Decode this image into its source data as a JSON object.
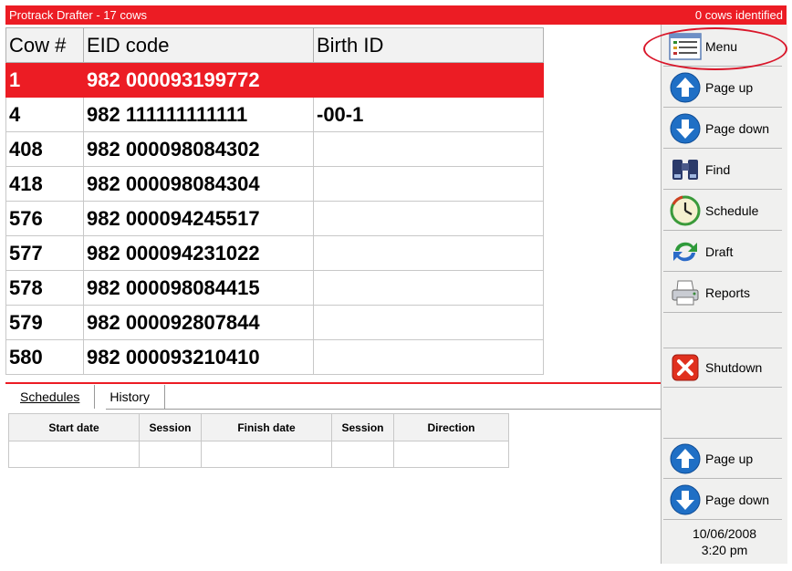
{
  "title": {
    "left": "Protrack Drafter - 17 cows",
    "right": "0 cows identified"
  },
  "cow_table": {
    "headers": [
      "Cow #",
      "EID code",
      "Birth ID"
    ],
    "rows": [
      [
        "1",
        "982 000093199772",
        ""
      ],
      [
        "4",
        "982 111111111111",
        "-00-1"
      ],
      [
        "408",
        "982 000098084302",
        ""
      ],
      [
        "418",
        "982 000098084304",
        ""
      ],
      [
        "576",
        "982 000094245517",
        ""
      ],
      [
        "577",
        "982 000094231022",
        ""
      ],
      [
        "578",
        "982 000098084415",
        ""
      ],
      [
        "579",
        "982 000092807844",
        ""
      ],
      [
        "580",
        "982 000093210410",
        ""
      ]
    ],
    "selected_row": 0
  },
  "tabs": [
    {
      "label": "Schedules",
      "underline": "S",
      "active": true
    },
    {
      "label": "History",
      "underline": "H",
      "active": false
    }
  ],
  "schedule_table": {
    "headers": [
      "Start date",
      "Session",
      "Finish date",
      "Session",
      "Direction"
    ]
  },
  "sidebar": {
    "menu": "Menu",
    "page_up": "Page up",
    "page_down": "Page down",
    "find": "Find",
    "schedule": "Schedule",
    "draft": "Draft",
    "reports": "Reports",
    "shutdown": "Shutdown",
    "page_up_2": "Page up",
    "page_down_2": "Page down",
    "date": "10/06/2008",
    "time": "3:20 pm"
  },
  "colors": {
    "accent": "#ec1c24",
    "icon_blue": "#1f6fc5",
    "highlight": "#d9162a"
  }
}
